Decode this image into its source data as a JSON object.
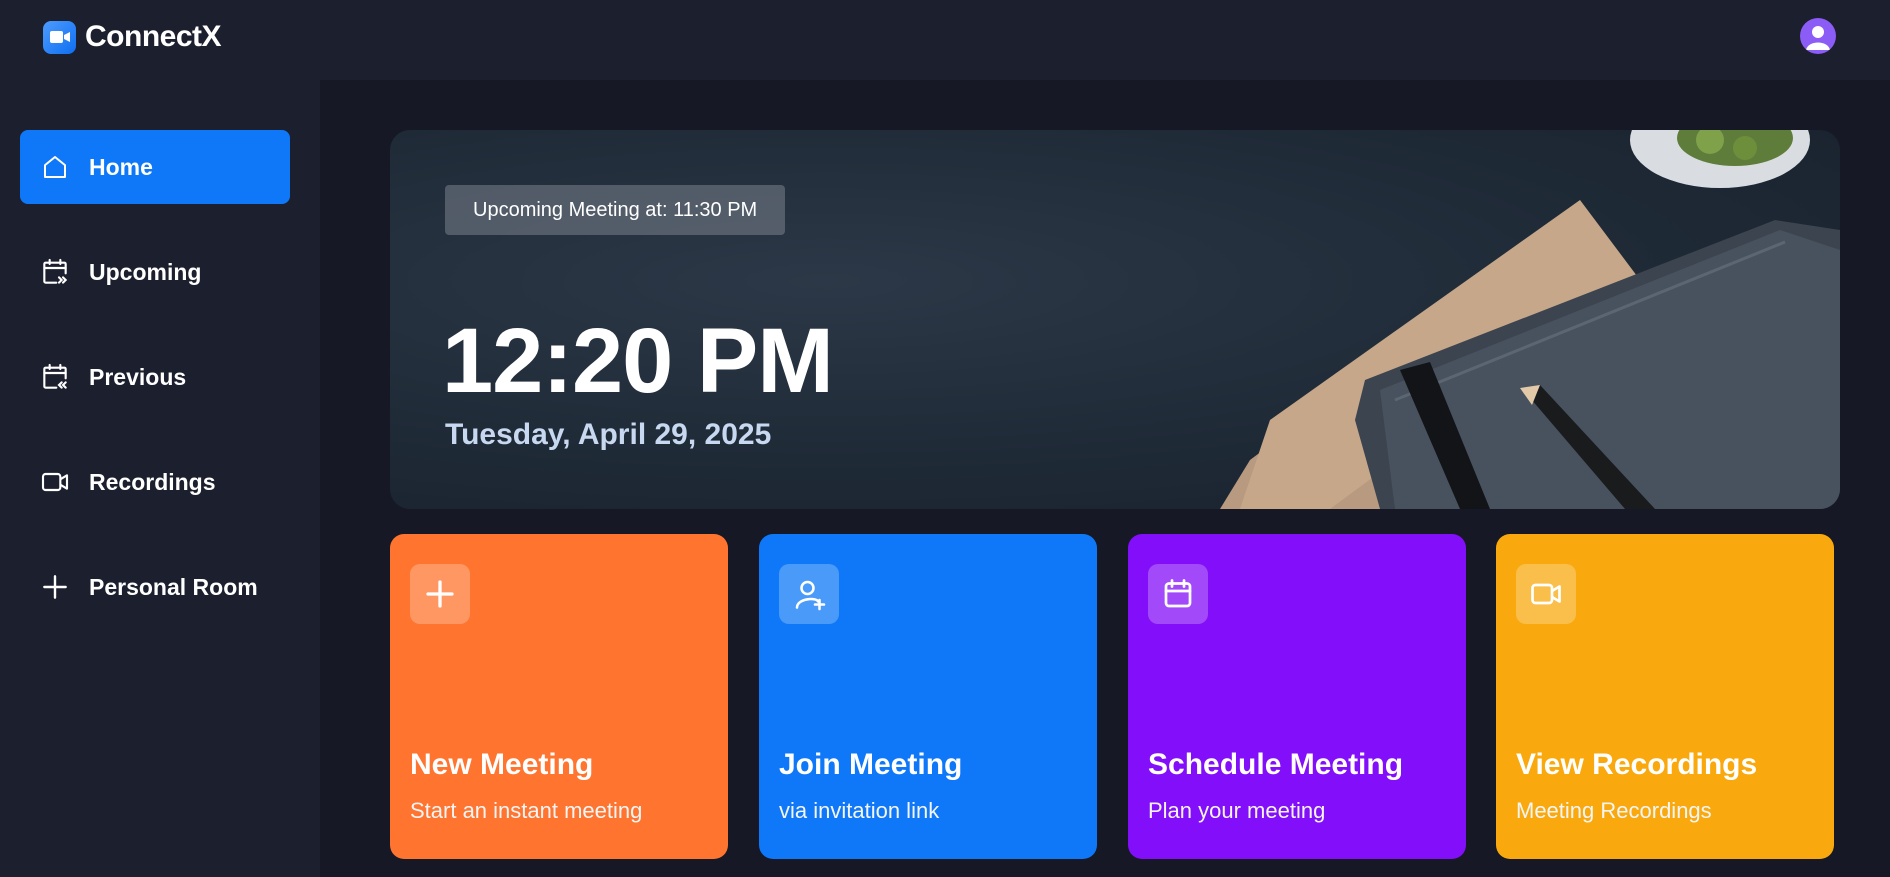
{
  "app": {
    "name": "ConnectX"
  },
  "sidebar": {
    "items": [
      {
        "label": "Home",
        "icon": "home-icon",
        "active": true
      },
      {
        "label": "Upcoming",
        "icon": "calendar-upcoming-icon"
      },
      {
        "label": "Previous",
        "icon": "calendar-previous-icon"
      },
      {
        "label": "Recordings",
        "icon": "video-icon"
      },
      {
        "label": "Personal Room",
        "icon": "plus-icon"
      }
    ]
  },
  "hero": {
    "badge": "Upcoming Meeting at: 11:30 PM",
    "time": "12:20 PM",
    "date": "Tuesday, April 29, 2025"
  },
  "cards": [
    {
      "title": "New Meeting",
      "subtitle": "Start an instant meeting",
      "color": "#ff742e",
      "icon": "plus-icon"
    },
    {
      "title": "Join Meeting",
      "subtitle": "via invitation link",
      "color": "#0e78f9",
      "icon": "user-plus-icon"
    },
    {
      "title": "Schedule Meeting",
      "subtitle": "Plan your meeting",
      "color": "#830ef9",
      "icon": "calendar-icon"
    },
    {
      "title": "View Recordings",
      "subtitle": "Meeting Recordings",
      "color": "#f9a90e",
      "icon": "video-icon"
    }
  ],
  "colors": {
    "background": "#161925",
    "panel": "#1c1f2e",
    "accent": "#0e78f9"
  }
}
